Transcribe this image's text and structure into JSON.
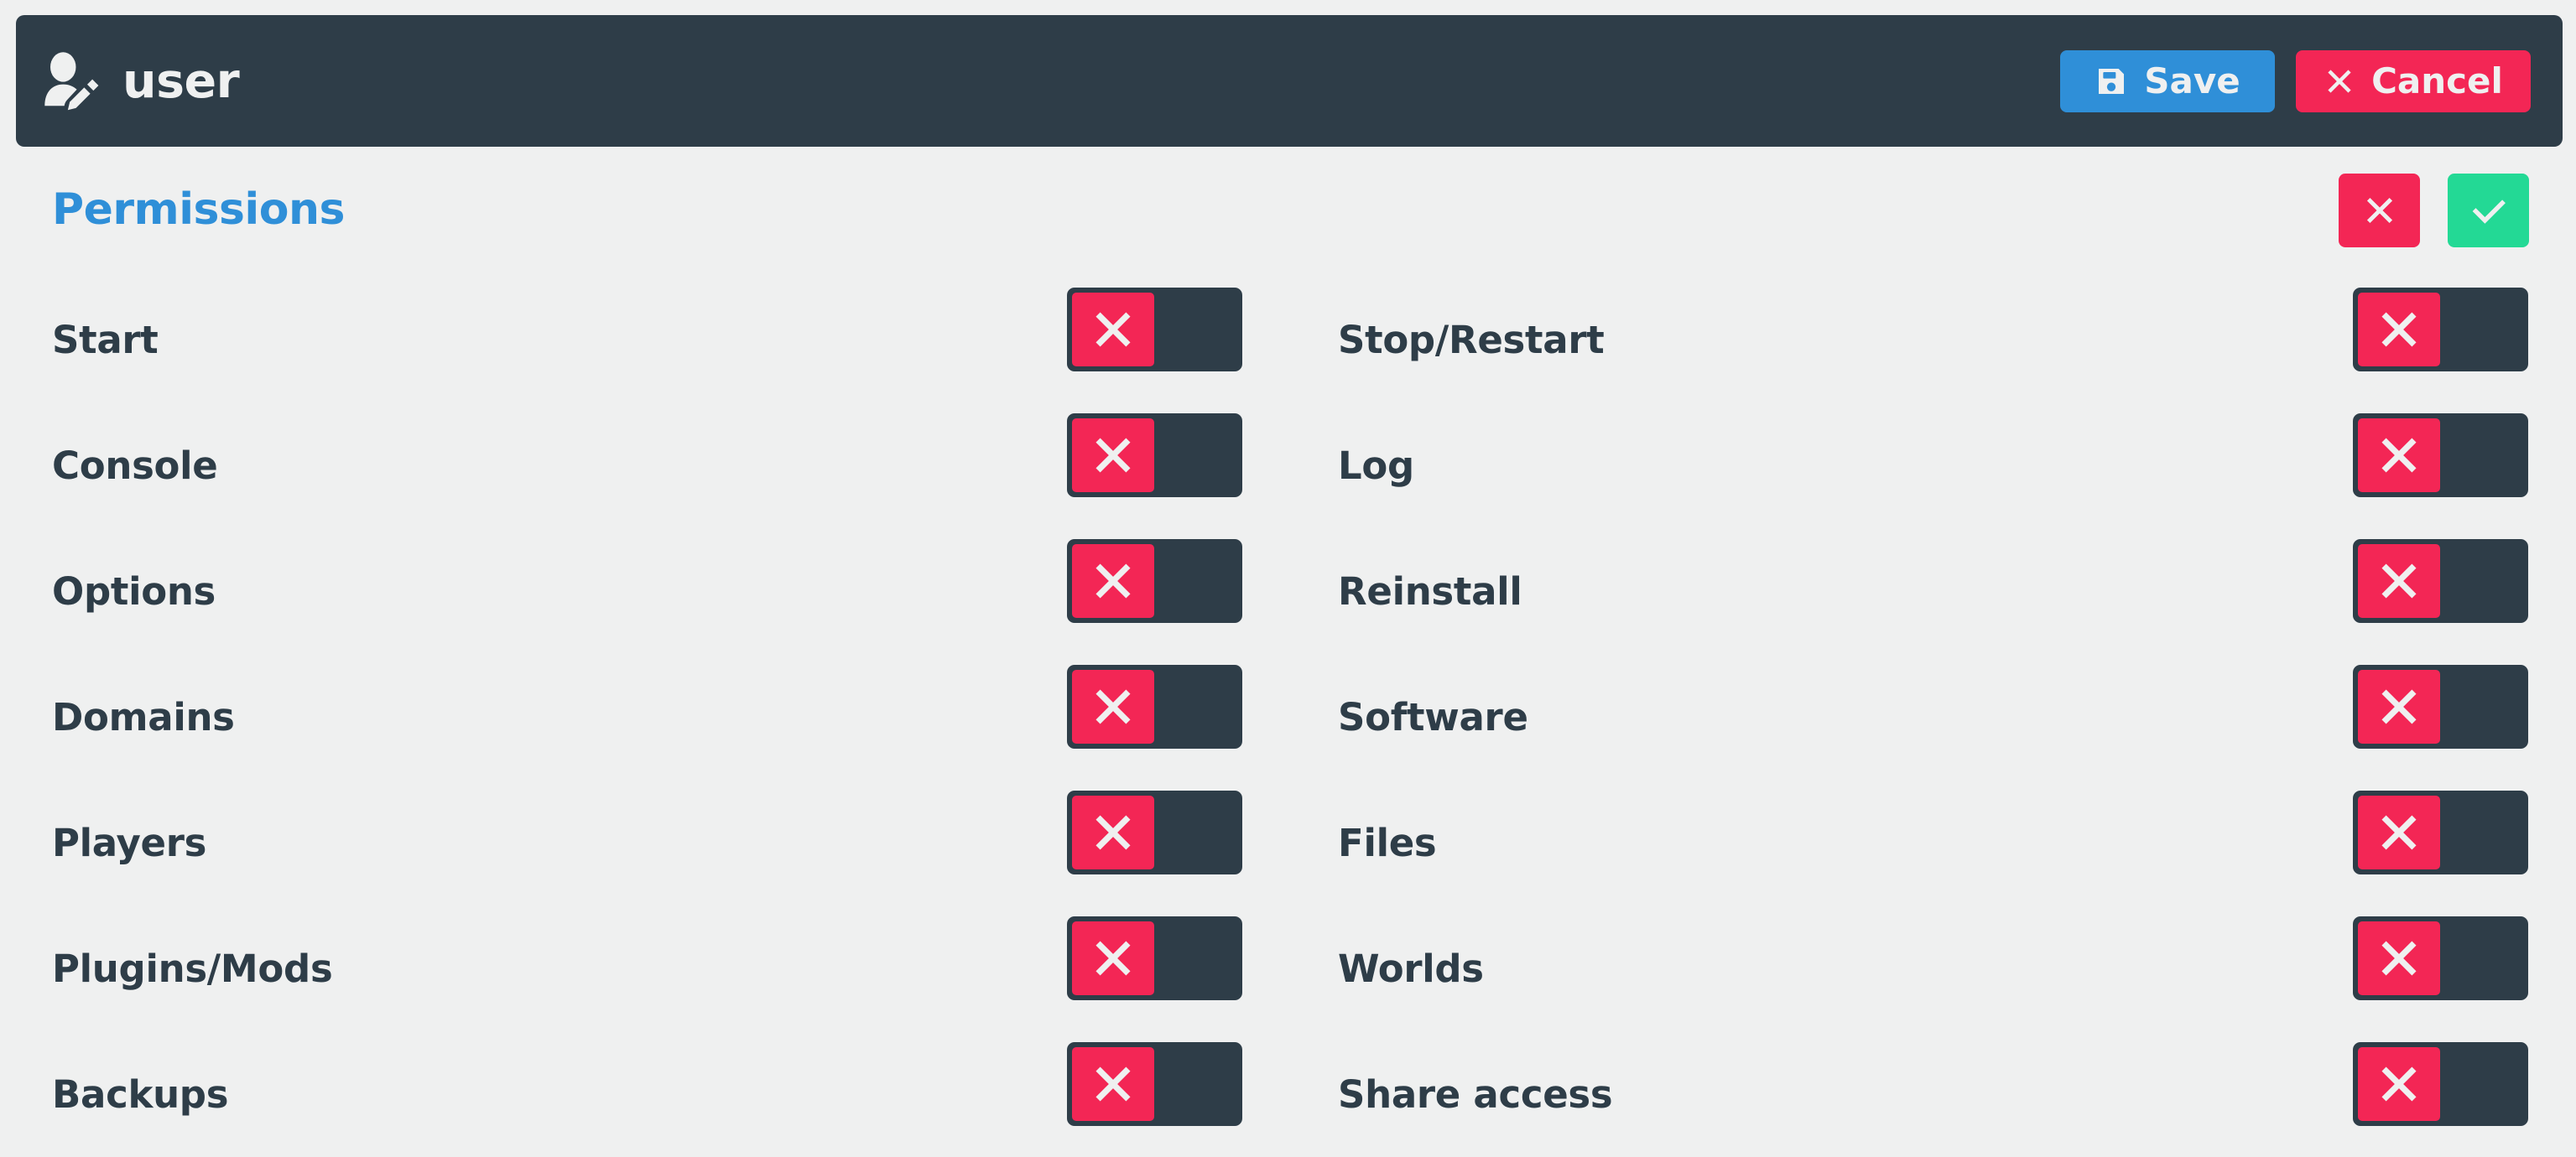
{
  "header": {
    "icon": "user-edit-icon",
    "title": "user",
    "save_label": "Save",
    "save_icon": "save-floppy-icon",
    "cancel_label": "Cancel",
    "cancel_icon": "close-x-icon",
    "background_color": "#2e3d48",
    "save_color": "#2f8fd8",
    "cancel_color": "#f32655"
  },
  "permissions_section": {
    "title": "Permissions",
    "title_color": "#2f8fd8",
    "deny_all_icon": "close-x-icon",
    "allow_all_icon": "check-icon",
    "deny_all_color": "#f32655",
    "allow_all_color": "#23d995"
  },
  "toggle_states": {
    "off_label": "off",
    "on_label": "on",
    "off_color": "#f32655",
    "on_color": "#23d995",
    "track_color": "#2e3d48",
    "off_icon": "close-x-icon",
    "on_icon": "check-icon"
  },
  "permissions": [
    {
      "left": {
        "label": "Start",
        "state": "off"
      },
      "right": {
        "label": "Stop/Restart",
        "state": "off"
      }
    },
    {
      "left": {
        "label": "Console",
        "state": "off"
      },
      "right": {
        "label": "Log",
        "state": "off"
      }
    },
    {
      "left": {
        "label": "Options",
        "state": "off"
      },
      "right": {
        "label": "Reinstall",
        "state": "off"
      }
    },
    {
      "left": {
        "label": "Domains",
        "state": "off"
      },
      "right": {
        "label": "Software",
        "state": "off"
      }
    },
    {
      "left": {
        "label": "Players",
        "state": "off"
      },
      "right": {
        "label": "Files",
        "state": "off"
      }
    },
    {
      "left": {
        "label": "Plugins/Mods",
        "state": "off"
      },
      "right": {
        "label": "Worlds",
        "state": "off"
      }
    },
    {
      "left": {
        "label": "Backups",
        "state": "off"
      },
      "right": {
        "label": "Share access",
        "state": "off"
      }
    }
  ]
}
